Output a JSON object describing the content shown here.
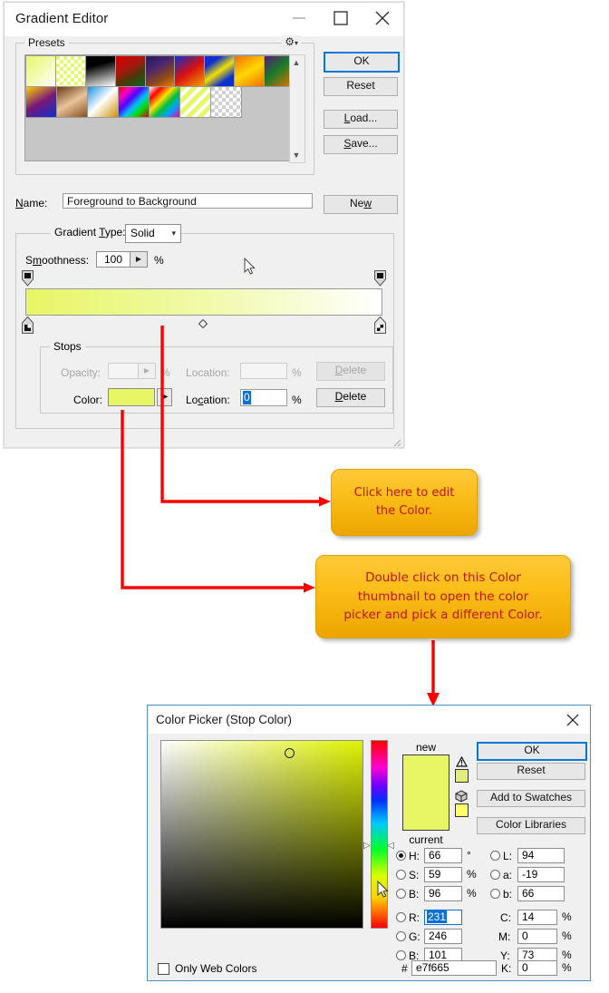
{
  "gradient_editor": {
    "title": "Gradient Editor",
    "window_controls": {
      "minimize": "minimize-icon",
      "maximize": "maximize-icon",
      "close": "close-icon"
    },
    "presets": {
      "label": "Presets",
      "gear_icon": "gear-icon",
      "scroll_up": "▲",
      "scroll_down": "▼",
      "swatches": [
        [
          "linear-gradient(135deg,#e7f665,#ffffff)",
          "checker-yellow",
          "linear-gradient(160deg,#000000 0%,#000000 35%,#ffffff 100%)",
          "linear-gradient(150deg,#cc0000 0%,#a01510 45%,#0a5c22 100%)",
          "linear-gradient(150deg,#241a5e 0%,#5a2d7a 40%,#e07a10 100%)",
          "linear-gradient(145deg,#0b2fd0 0%,#d81010 55%,#f0a000 100%)",
          "linear-gradient(145deg,#0b2fd0 0%,#f0e000 50%,#0b2fd0 100%)",
          "linear-gradient(150deg,#f07000 0%,#ffd000 50%,#f07000 100%)",
          "linear-gradient(140deg,#5a1878 0%,#1a7a2a 45%,#f07000 100%)"
        ],
        [
          "linear-gradient(150deg,#ffd000 0%,#7a1878 45%,#0b2fd0 100%)",
          "linear-gradient(150deg,#6b3a14 0%,#e8c49a 50%,#8a5020 100%)",
          "linear-gradient(135deg,#1890e0 0%,#ffffff 50%,#d09000 100%)",
          "rainbow",
          "rainbow-white",
          "yellow-stripes",
          "checker-gray"
        ]
      ]
    },
    "buttons": {
      "ok": "OK",
      "reset": "Reset",
      "load": "Load...",
      "save": "Save...",
      "new": "New"
    },
    "name": {
      "label": "Name:",
      "value": "Foreground to Background"
    },
    "gradient_type": {
      "label": "Gradient Type:",
      "value": "Solid",
      "chevron_icon": "chevron-down-icon"
    },
    "smoothness": {
      "label": "Smoothness:",
      "value": "100",
      "unit": "%",
      "spinner_icon": "triangle-right-icon"
    },
    "gradient_bar": {
      "from_color": "#e7f665",
      "to_color": "#ffffff",
      "midpoint_icon": "diamond-icon"
    },
    "stops": {
      "label": "Stops",
      "opacity_label": "Opacity:",
      "opacity_value": "",
      "opacity_unit": "%",
      "location_top_label": "Location:",
      "location_top_value": "",
      "location_top_unit": "%",
      "delete_top": "Delete",
      "color_label": "Color:",
      "color_value": "#e7f665",
      "color_arrow_icon": "triangle-right-icon",
      "location_label": "Location:",
      "location_value": "0",
      "location_unit": "%",
      "delete": "Delete"
    },
    "cursor_icon": "mouse-pointer-icon"
  },
  "callouts": [
    {
      "lines": [
        "Click here to edit",
        "the Color."
      ]
    },
    {
      "lines": [
        "Double click on this Color",
        "thumbnail  to open the color",
        "picker and pick a different Color."
      ]
    }
  ],
  "color_picker": {
    "title": "Color Picker (Stop Color)",
    "close_icon": "close-icon",
    "field_marker_icon": "circle-marker-icon",
    "hue_cursor_icon": "mouse-pointer-icon",
    "new_label": "new",
    "current_label": "current",
    "new_color": "#e7f665",
    "current_color": "#e7f665",
    "warning_icon": "out-of-gamut-warning-icon",
    "warning_swatch": "#e2ed77",
    "web_icon": "web-safe-cube-icon",
    "web_swatch": "#ffff66",
    "buttons": {
      "ok": "OK",
      "reset": "Reset",
      "add_to_swatches": "Add to Swatches",
      "color_libraries": "Color Libraries"
    },
    "hsb": [
      {
        "key": "H:",
        "value": "66",
        "unit": "°",
        "selected": true
      },
      {
        "key": "S:",
        "value": "59",
        "unit": "%",
        "selected": false
      },
      {
        "key": "B:",
        "value": "96",
        "unit": "%",
        "selected": false
      }
    ],
    "rgb": [
      {
        "key": "R:",
        "value": "231",
        "unit": "",
        "selected": false,
        "highlighted": true
      },
      {
        "key": "G:",
        "value": "246",
        "unit": "",
        "selected": false,
        "highlighted": false
      },
      {
        "key": "B:",
        "value": "101",
        "unit": "",
        "selected": false,
        "highlighted": false
      }
    ],
    "lab": [
      {
        "key": "L:",
        "value": "94",
        "unit": "",
        "selected": false
      },
      {
        "key": "a:",
        "value": "-19",
        "unit": "",
        "selected": false
      },
      {
        "key": "b:",
        "value": "66",
        "unit": "",
        "selected": false
      }
    ],
    "cmyk": [
      {
        "key": "C:",
        "value": "14",
        "unit": "%"
      },
      {
        "key": "M:",
        "value": "0",
        "unit": "%"
      },
      {
        "key": "Y:",
        "value": "73",
        "unit": "%"
      },
      {
        "key": "K:",
        "value": "0",
        "unit": "%"
      }
    ],
    "only_web_colors": "Only Web Colors",
    "hash": "#",
    "hex_value": "e7f665"
  }
}
